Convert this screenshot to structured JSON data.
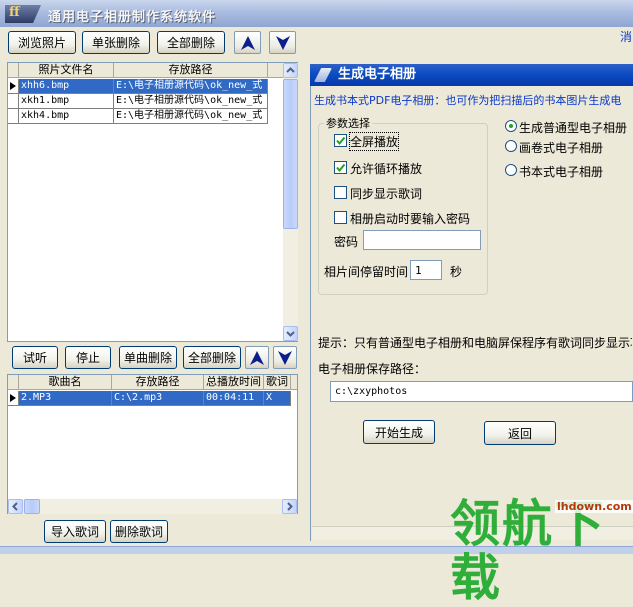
{
  "window": {
    "title": "通用电子相册制作系统软件",
    "logo_text": "ff",
    "right_edge_text": "消"
  },
  "toolbar": {
    "browse_label": "浏览照片",
    "delete_one_label": "单张删除",
    "delete_all_label": "全部删除"
  },
  "photo_list": {
    "columns": [
      "照片文件名",
      "存放路径"
    ],
    "rows": [
      {
        "name": "xhh6.bmp",
        "path": "E:\\电子相册源代码\\ok_new_式",
        "selected": true
      },
      {
        "name": "xkh1.bmp",
        "path": "E:\\电子相册源代码\\ok_new_式",
        "selected": false
      },
      {
        "name": "xkh4.bmp",
        "path": "E:\\电子相册源代码\\ok_new_式",
        "selected": false
      }
    ]
  },
  "music_toolbar": {
    "listen_label": "试听",
    "stop_label": "停止",
    "delete_one_label": "单曲删除",
    "delete_all_label": "全部删除"
  },
  "music_list": {
    "columns": [
      "歌曲名",
      "存放路径",
      "总播放时间",
      "歌词"
    ],
    "rows": [
      {
        "name": "2.MP3",
        "path": "C:\\2.mp3",
        "duration": "00:04:11",
        "lyric": "X",
        "selected": true
      }
    ]
  },
  "lyrics_buttons": {
    "import_label": "导入歌词",
    "delete_label": "删除歌词"
  },
  "album_panel": {
    "title": "生成电子相册",
    "info": "生成书本式PDF电子相册：也可作为把扫描后的书本图片生成电",
    "group_title": "参数选择",
    "options": [
      {
        "label": "全屏播放",
        "checked": true
      },
      {
        "label": "允许循环播放",
        "checked": true
      },
      {
        "label": "同步显示歌词",
        "checked": false
      },
      {
        "label": "相册启动时要输入密码",
        "checked": false
      }
    ],
    "password_label": "密码",
    "password_value": "",
    "interval_label": "相片间停留时间",
    "interval_value": "1",
    "interval_unit": "秒",
    "album_types": [
      {
        "label": "生成普通型电子相册",
        "selected": true
      },
      {
        "label": "画卷式电子相册",
        "selected": false
      },
      {
        "label": "书本式电子相册",
        "selected": false
      }
    ],
    "tip": "提示：只有普通型电子相册和电脑屏保程序有歌词同步显示功",
    "save_path_label": "电子相册保存路径：",
    "save_path_value": "c:\\zxyphotos",
    "generate_label": "开始生成",
    "back_label": "返回"
  },
  "watermark": {
    "text": "领航下载",
    "site": "lhdown.com"
  },
  "colors": {
    "accent_blue": "#0A4AC2",
    "selection": "#316AC5",
    "info_text": "#0A38C8",
    "watermark": "#2FAF3A"
  }
}
